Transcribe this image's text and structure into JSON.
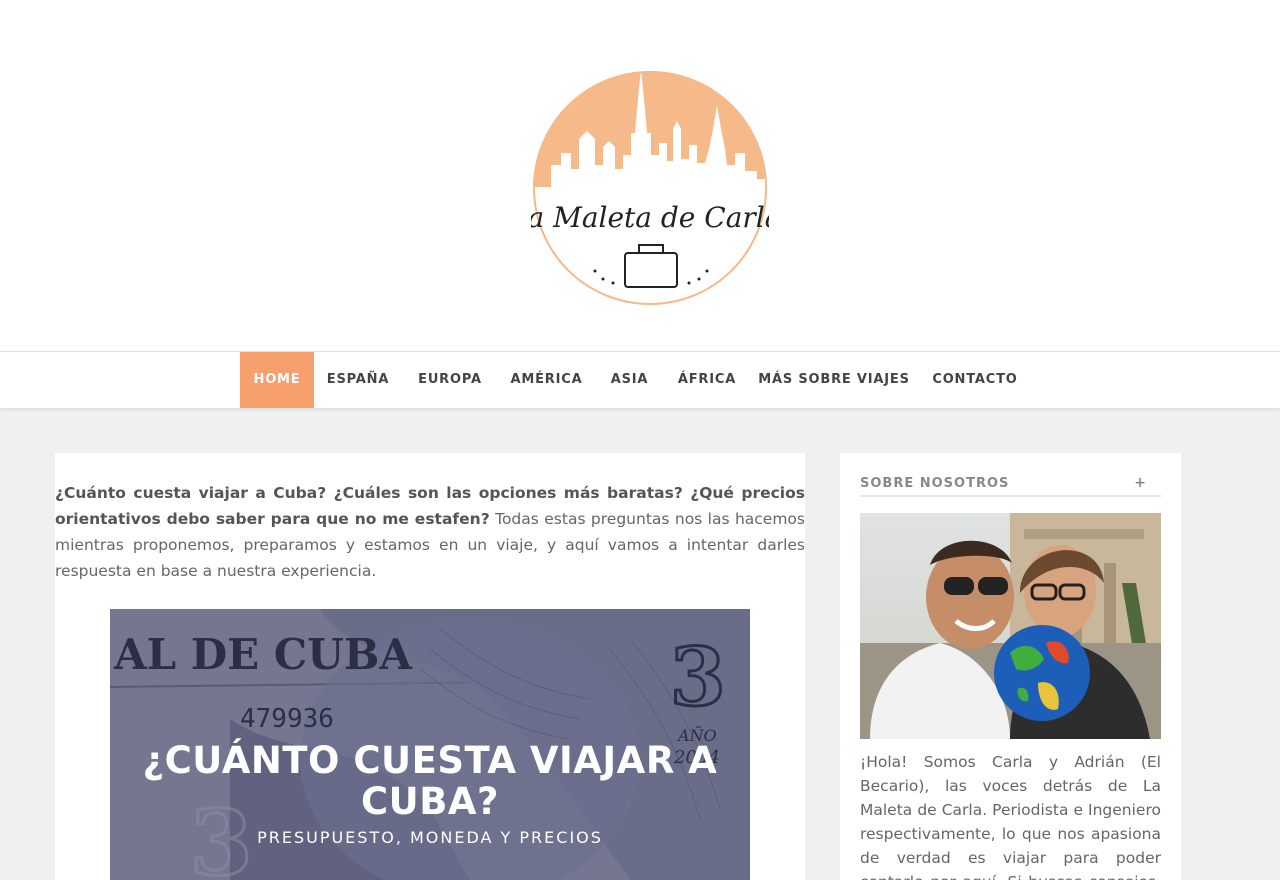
{
  "logo": {
    "line1": "la Maleta de Carla",
    "brand_color": "#f6b98a"
  },
  "nav": {
    "items": [
      {
        "label": "HOME",
        "active": true
      },
      {
        "label": "ESPAÑA"
      },
      {
        "label": "EUROPA"
      },
      {
        "label": "AMÉRICA"
      },
      {
        "label": "ASIA"
      },
      {
        "label": "ÁFRICA"
      },
      {
        "label": "MÁS SOBRE VIAJES"
      },
      {
        "label": "CONTACTO"
      }
    ],
    "active_color": "#f89f6e"
  },
  "post": {
    "intro_bold": "¿Cuánto cuesta viajar a Cuba? ¿Cuáles son las opciones más baratas? ¿Qué precios orientativos debo saber para que no me estafen?",
    "intro_rest": " Todas estas preguntas nos las hacemos mientras proponemos, preparamos y estamos en un viaje, y aquí vamos a intentar darles respuesta en base a nuestra experiencia.",
    "hero": {
      "banknote_text": "AL DE CUBA",
      "banknote_number": "479936",
      "banknote_year_label": "AÑO",
      "banknote_year": "2004",
      "banknote_denomination": "3",
      "title": "¿CUÁNTO CUESTA VIAJAR A CUBA?",
      "subtitle": "PRESUPUESTO, MONEDA Y PRECIOS"
    }
  },
  "sidebar": {
    "widget_title": "SOBRE NOSOTROS",
    "widget_toggle": "+",
    "about_text": "¡Hola! Somos Carla y Adrián (El Becario), las voces detrás de La Maleta de Carla. Periodista e Ingeniero respectivamente, lo que nos apasiona de verdad es viajar para poder contarlo por aquí. Si buscas consejos, experiencias y destinos"
  }
}
